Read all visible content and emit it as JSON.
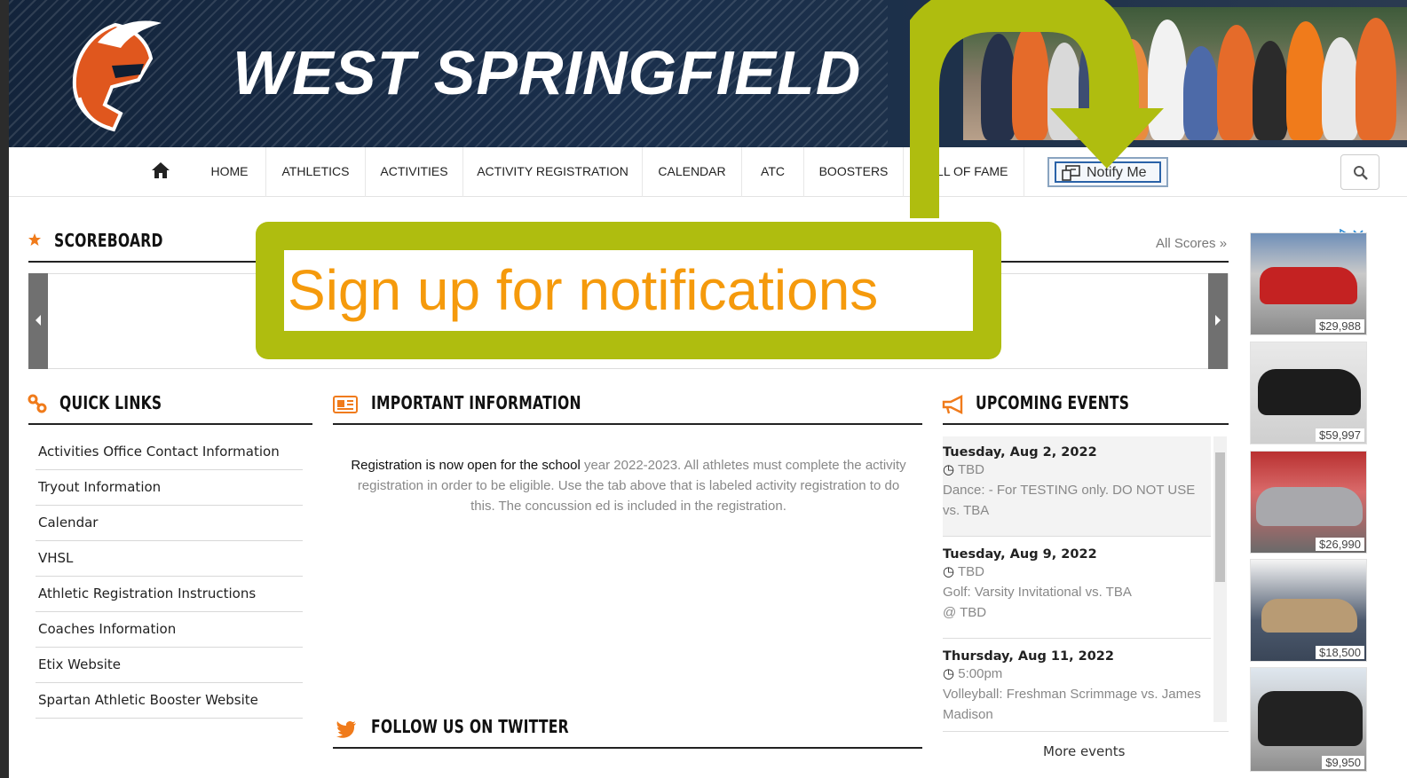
{
  "header": {
    "title": "WEST SPRINGFIELD"
  },
  "nav": {
    "items": [
      {
        "label": "HOME"
      },
      {
        "label": "ATHLETICS"
      },
      {
        "label": "ACTIVITIES"
      },
      {
        "label": "ACTIVITY REGISTRATION"
      },
      {
        "label": "CALENDAR"
      },
      {
        "label": "ATC"
      },
      {
        "label": "BOOSTERS"
      },
      {
        "label": "HALL OF FAME"
      }
    ],
    "notify_label": "Notify Me",
    "home_icon": "home-icon",
    "search_icon": "search-icon"
  },
  "scoreboard": {
    "title": "SCOREBOARD",
    "all_scores": "All Scores »"
  },
  "quick_links": {
    "title": "QUICK LINKS",
    "items": [
      "Activities Office Contact Information",
      "Tryout Information",
      "Calendar",
      "VHSL",
      "Athletic Registration Instructions",
      "Coaches Information",
      "Etix Website",
      "Spartan Athletic Booster Website"
    ]
  },
  "important_info": {
    "title": "IMPORTANT INFORMATION",
    "text_dark": "Registration is now open for the school",
    "text_light": " year 2022-2023. All athletes must complete the activity registration in order to be eligible. Use the tab above that is labeled activity registration to do this. The concussion ed is included in the registration."
  },
  "twitter": {
    "title": "FOLLOW US ON TWITTER"
  },
  "events": {
    "title": "UPCOMING EVENTS",
    "items": [
      {
        "date": "Tuesday, Aug 2, 2022",
        "time": "TBD",
        "desc": "Dance: - For TESTING only. DO NOT USE",
        "vs": "vs. TBA",
        "loc": ""
      },
      {
        "date": "Tuesday, Aug 9, 2022",
        "time": "TBD",
        "desc": "Golf: Varsity Invitational vs. TBA",
        "vs": "",
        "loc": "@ TBD"
      },
      {
        "date": "Thursday, Aug 11, 2022",
        "time": "5:00pm",
        "desc": "Volleyball: Freshman Scrimmage vs. James",
        "vs": "Madison",
        "loc": ""
      }
    ],
    "more": "More events"
  },
  "ads": [
    {
      "price": "$29,988",
      "color": "#c42222"
    },
    {
      "price": "$59,997",
      "color": "#1c1c1c"
    },
    {
      "price": "$26,990",
      "color": "#a8a8ac"
    },
    {
      "price": "$18,500",
      "color": "#b89b74"
    },
    {
      "price": "$9,950",
      "color": "#222222"
    }
  ],
  "overlay": {
    "text": "Sign up for notifications"
  },
  "colors": {
    "accent_orange": "#f07b1b",
    "overlay_green": "#afbd0f",
    "overlay_text": "#f59a0c",
    "header_navy": "#13243b"
  }
}
